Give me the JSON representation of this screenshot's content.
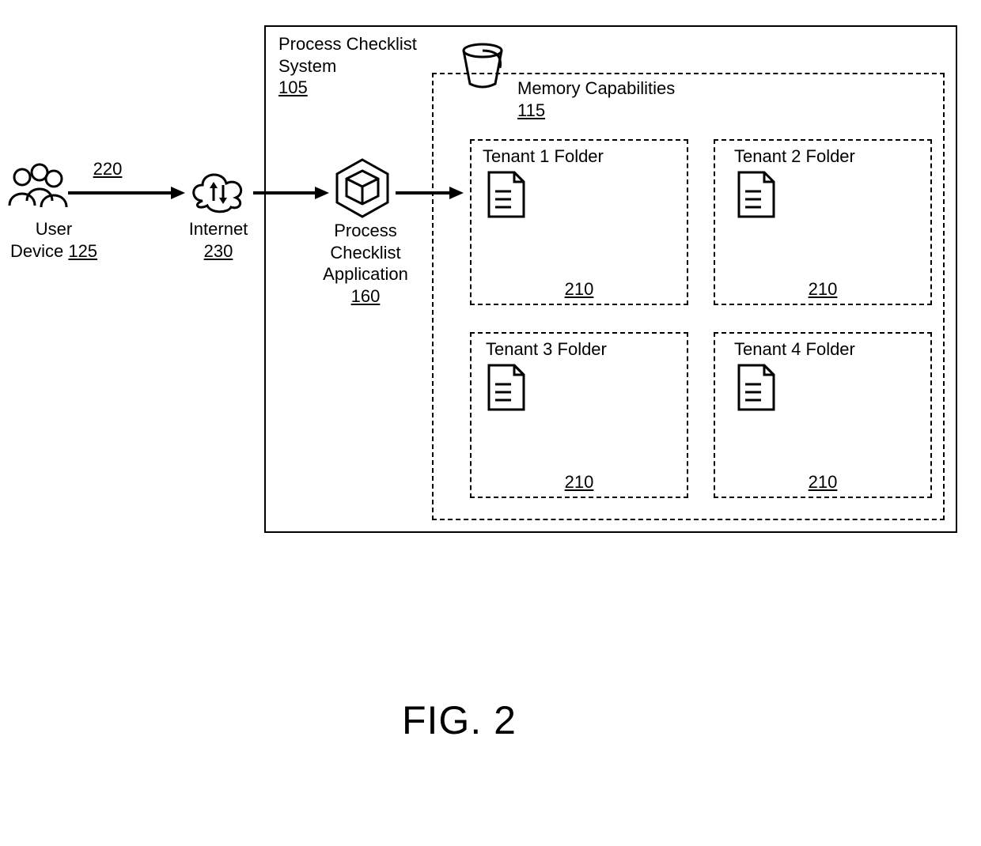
{
  "arrow_ref": "220",
  "user_device": {
    "label": "User",
    "label2": "Device",
    "ref": "125"
  },
  "internet": {
    "label": "Internet",
    "ref": "230"
  },
  "app": {
    "label1": "Process",
    "label2": "Checklist",
    "label3": "Application",
    "ref": "160"
  },
  "system": {
    "label1": "Process Checklist",
    "label2": "System",
    "ref": "105"
  },
  "memory": {
    "label": "Memory Capabilities",
    "ref": "115"
  },
  "tenants": {
    "t1": {
      "title": "Tenant 1 Folder",
      "ref": "210"
    },
    "t2": {
      "title": "Tenant 2 Folder",
      "ref": "210"
    },
    "t3": {
      "title": "Tenant 3 Folder",
      "ref": "210"
    },
    "t4": {
      "title": "Tenant 4 Folder",
      "ref": "210"
    }
  },
  "figure_caption": "FIG. 2"
}
